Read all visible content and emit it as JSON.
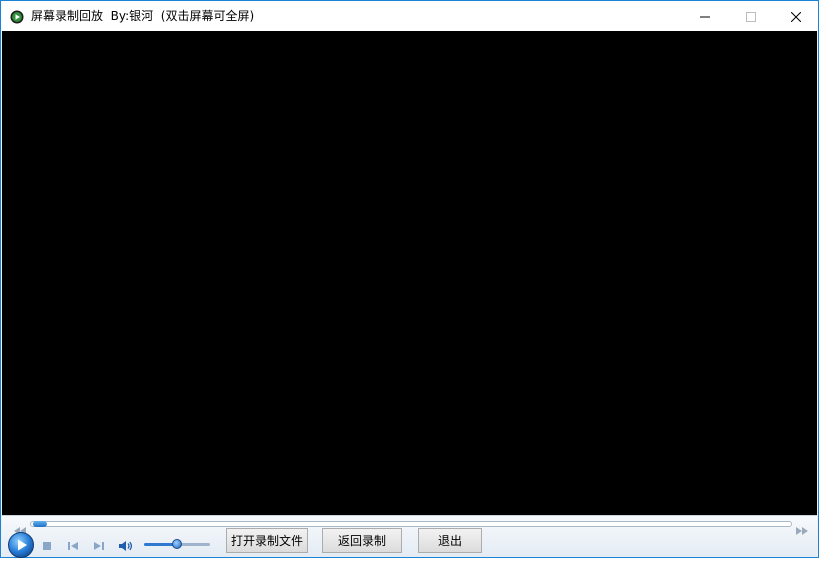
{
  "window": {
    "title": "屏幕录制回放  By:银河  (双击屏幕可全屏)",
    "app_icon": "play-circle-icon",
    "controls": {
      "minimize_icon": "minimize-icon",
      "maximize_icon": "maximize-icon",
      "close_icon": "close-icon"
    }
  },
  "player": {
    "progress_fraction": 0.0,
    "volume_fraction": 0.5,
    "icons": {
      "seek_back": "seek-back-icon",
      "seek_forward": "seek-forward-icon",
      "play": "play-icon",
      "stop": "stop-icon",
      "previous": "previous-icon",
      "next": "next-icon",
      "volume": "volume-icon"
    }
  },
  "buttons": {
    "open_file": "打开录制文件",
    "back_to_record": "返回录制",
    "exit": "退出"
  },
  "colors": {
    "accent": "#1883d7",
    "video_background": "#000000",
    "control_blue": "#2e78d0"
  }
}
